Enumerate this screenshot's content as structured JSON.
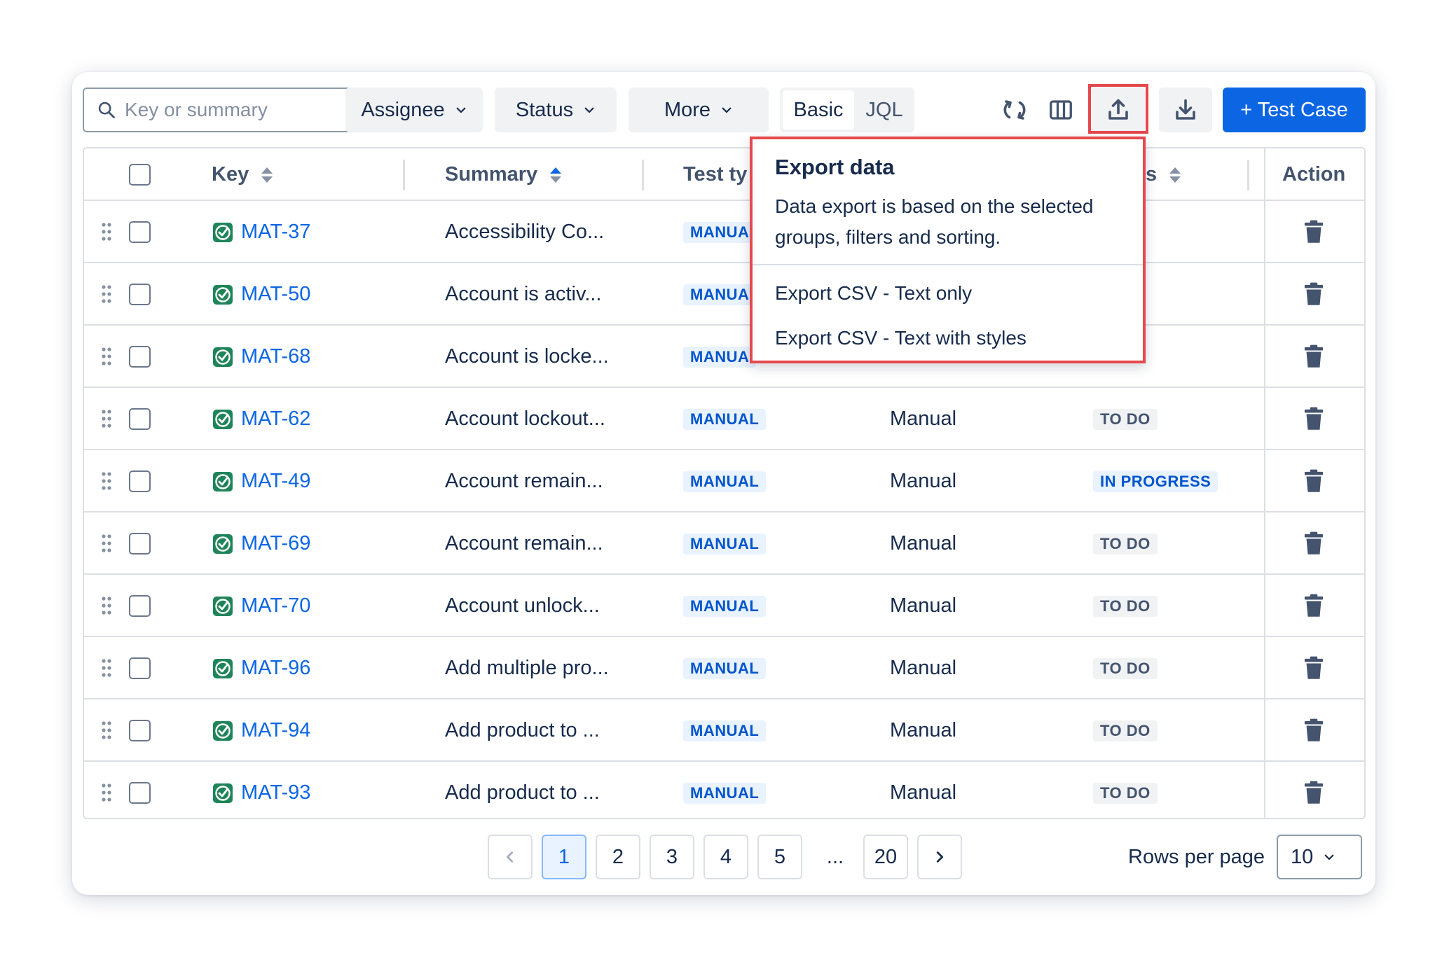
{
  "toolbar": {
    "search_placeholder": "Key or summary",
    "filters": [
      "Assignee",
      "Status",
      "More"
    ],
    "query_modes": {
      "basic": "Basic",
      "jql": "JQL"
    },
    "primary_button": "+ Test Case"
  },
  "table": {
    "headers": {
      "key": "Key",
      "summary": "Summary",
      "test_type": "Test ty",
      "status_partial": "s",
      "action": "Action"
    },
    "rows": [
      {
        "key": "MAT-37",
        "summary": "Accessibility Co...",
        "type": "MANUA",
        "method": "",
        "status": ""
      },
      {
        "key": "MAT-50",
        "summary": "Account is activ...",
        "type": "MANUA",
        "method": "",
        "status": ""
      },
      {
        "key": "MAT-68",
        "summary": "Account is locke...",
        "type": "MANUA",
        "method": "",
        "status": ""
      },
      {
        "key": "MAT-62",
        "summary": "Account lockout...",
        "type": "MANUAL",
        "method": "Manual",
        "status": "TO DO"
      },
      {
        "key": "MAT-49",
        "summary": "Account remain...",
        "type": "MANUAL",
        "method": "Manual",
        "status": "IN PROGRESS"
      },
      {
        "key": "MAT-69",
        "summary": "Account remain...",
        "type": "MANUAL",
        "method": "Manual",
        "status": "TO DO"
      },
      {
        "key": "MAT-70",
        "summary": "Account unlock...",
        "type": "MANUAL",
        "method": "Manual",
        "status": "TO DO"
      },
      {
        "key": "MAT-96",
        "summary": "Add multiple pro...",
        "type": "MANUAL",
        "method": "Manual",
        "status": "TO DO"
      },
      {
        "key": "MAT-94",
        "summary": "Add product to ...",
        "type": "MANUAL",
        "method": "Manual",
        "status": "TO DO"
      },
      {
        "key": "MAT-93",
        "summary": "Add product to ...",
        "type": "MANUAL",
        "method": "Manual",
        "status": "TO DO"
      }
    ]
  },
  "export_menu": {
    "title": "Export data",
    "description": "Data export is based on the selected groups, filters and sorting.",
    "items": [
      "Export CSV - Text only",
      "Export CSV - Text with styles"
    ]
  },
  "pagination": {
    "pages": [
      "1",
      "2",
      "3",
      "4",
      "5"
    ],
    "ellipsis": "...",
    "last_page": "20",
    "current": "1",
    "rows_per_page_label": "Rows per page",
    "rows_per_page_value": "10"
  },
  "colors": {
    "primary": "#0c66e4",
    "highlight": "#e5484d",
    "key_icon": "#1f845a"
  },
  "icons": {
    "search": "search-icon",
    "refresh": "refresh-icon",
    "columns": "columns-icon",
    "export": "upload-icon",
    "download": "download-icon",
    "delete": "trash-icon",
    "drag": "drag-handle-icon",
    "test_case": "test-case-check-icon"
  }
}
